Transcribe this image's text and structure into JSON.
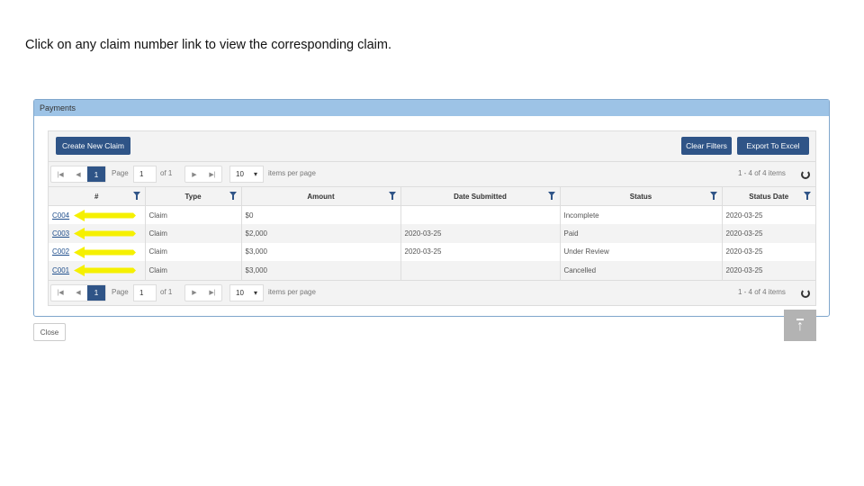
{
  "instruction": "Click on any claim number link to view the corresponding claim.",
  "panel": {
    "title": "Payments"
  },
  "toolbar": {
    "create": "Create New Claim",
    "clear": "Clear Filters",
    "export": "Export To Excel"
  },
  "pager": {
    "current": "1",
    "page_label": "Page",
    "page_value": "1",
    "of_label": "of 1",
    "page_size": "10",
    "per_page": "items per page",
    "summary": "1 - 4 of 4 items"
  },
  "columns": [
    "#",
    "Type",
    "Amount",
    "Date Submitted",
    "Status",
    "Status Date"
  ],
  "rows": [
    {
      "id": "C004",
      "type": "Claim",
      "amount": "$0",
      "submitted": "",
      "status": "Incomplete",
      "status_date": "2020-03-25"
    },
    {
      "id": "C003",
      "type": "Claim",
      "amount": "$2,000",
      "submitted": "2020-03-25",
      "status": "Paid",
      "status_date": "2020-03-25"
    },
    {
      "id": "C002",
      "type": "Claim",
      "amount": "$3,000",
      "submitted": "2020-03-25",
      "status": "Under Review",
      "status_date": "2020-03-25"
    },
    {
      "id": "C001",
      "type": "Claim",
      "amount": "$3,000",
      "submitted": "",
      "status": "Cancelled",
      "status_date": "2020-03-25"
    }
  ],
  "close": "Close",
  "scroll_top_icon": "arrow-up-to-line-icon",
  "highlight_color": "#f5f000"
}
